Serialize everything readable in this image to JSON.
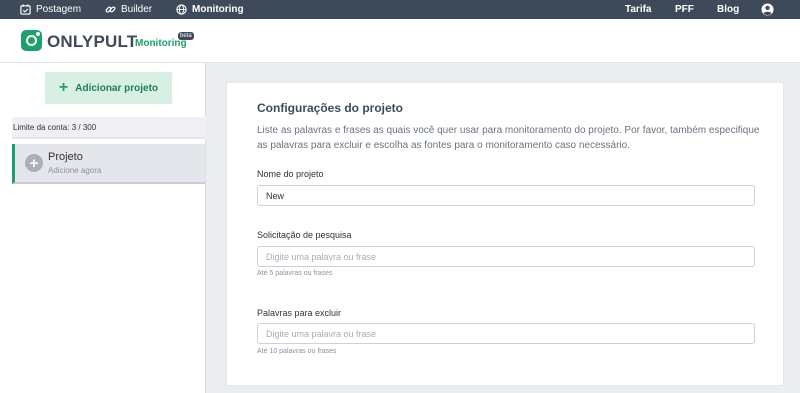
{
  "topnav": {
    "items": [
      {
        "label": "Postagem",
        "icon": "calendar-check-icon"
      },
      {
        "label": "Builder",
        "icon": "link-icon"
      },
      {
        "label": "Monitoring",
        "icon": "globe-icon"
      }
    ],
    "right": [
      "Tarifa",
      "PFF",
      "Blog"
    ],
    "account_icon": "user-circle-icon"
  },
  "header": {
    "brand": "ONLYPULT",
    "product": "Monitoring",
    "badge": "beta"
  },
  "sidebar": {
    "add_project_label": "Adicionar projeto",
    "limit_text": "Limite da conta: 3 / 300",
    "project": {
      "title": "Projeto",
      "subtitle": "Adicione agora"
    }
  },
  "settings": {
    "title": "Configurações do projeto",
    "description": "Liste as palavras e frases as quais você quer usar para monitoramento do projeto. Por favor, também especifique as palavras para excluir e escolha as fontes para o monitoramento caso necessário.",
    "fields": [
      {
        "label": "Nome do projeto",
        "value": "New",
        "placeholder": "",
        "hint": ""
      },
      {
        "label": "Solicitação de pesquisa",
        "value": "",
        "placeholder": "Digite uma palavra ou frase",
        "hint": "Até 5 palavras ou frases"
      },
      {
        "label": "Palavras para excluir",
        "value": "",
        "placeholder": "Digite uma palavra ou frase",
        "hint": "Até 10 palavras ou frases"
      }
    ]
  },
  "colors": {
    "nav_bg": "#3e4a59",
    "brand_green": "#20a06a",
    "add_button_bg": "#d7f0e3",
    "page_bg": "#ebedf0"
  }
}
